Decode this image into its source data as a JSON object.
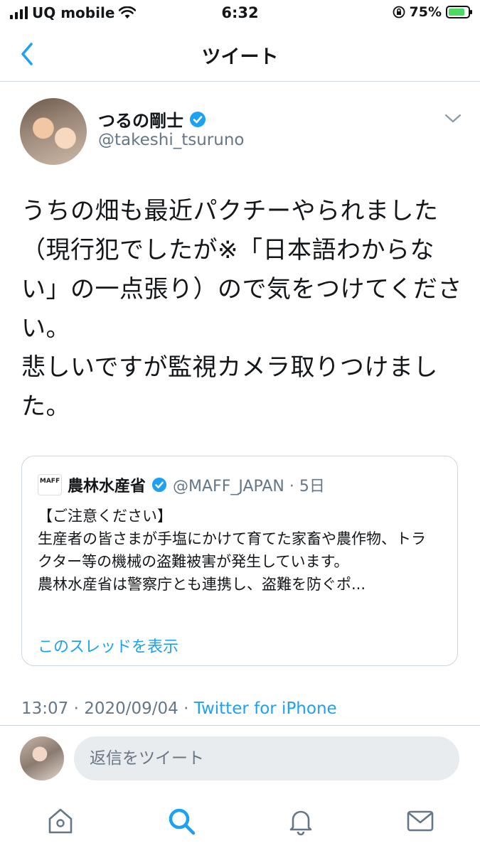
{
  "status_bar": {
    "carrier": "UQ mobile",
    "time": "6:32",
    "battery": "75%",
    "battery_level": 0.75
  },
  "nav": {
    "title": "ツイート",
    "back_icon": "chevron-left-icon"
  },
  "tweet": {
    "author_name": "つるの剛士",
    "author_handle": "@takeshi_tsuruno",
    "text": "うちの畑も最近パクチーやられました（現行犯でしたが※「日本語わからない」の一点張り）ので気をつけてください。\n悲しいですが監視カメラ取りつけました。",
    "timestamp": "13:07 · 2020/09/04 · ",
    "source": "Twitter for iPhone"
  },
  "quoted_tweet": {
    "logo_text": "MAFF",
    "author_name": "農林水産省",
    "author_handle": "@MAFF_JAPAN · 5日",
    "body": "【ご注意ください】\n生産者の皆さまが手塩にかけて育てた家畜や農作物、トラクター等の機械の盗難被害が発生しています。\n農林水産省は警察庁とも連携し、盗難を防ぐポ...",
    "show_thread": "このスレッドを表示"
  },
  "reply": {
    "placeholder": "返信をツイート"
  },
  "tabs": [
    "home-icon",
    "search-icon",
    "notifications-icon",
    "messages-icon"
  ],
  "colors": {
    "accent": "#1da1f2",
    "muted": "#657786",
    "border": "#ccd6dd"
  }
}
